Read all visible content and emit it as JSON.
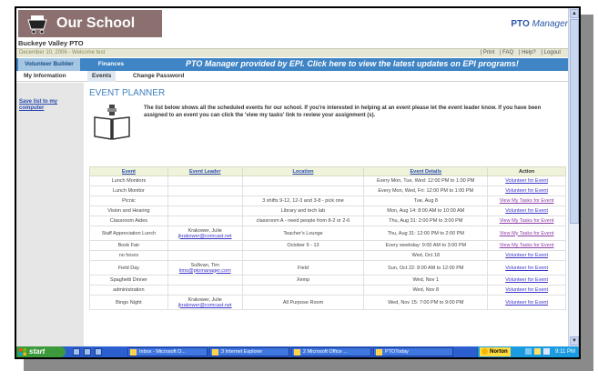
{
  "header": {
    "site_title": "Our School",
    "brand_main": "PTO",
    "brand_sub": "Manager",
    "org_name": "Buckeye Valley PTO"
  },
  "infobar": {
    "date_welcome": "December 10, 2006 - Welcome test",
    "links": [
      "| Print",
      "| FAQ",
      "| Help?",
      "| Logout"
    ]
  },
  "nav": {
    "tab_volunteer": "Volunteer Builder",
    "tab_finances": "Finances",
    "promo": "PTO Manager provided by EPI.  Click here to view the latest updates on EPI programs!"
  },
  "subnav": {
    "my_information": "My Information",
    "events": "Events",
    "change_password": "Change Password"
  },
  "sidebar": {
    "save_link": "Save list to my computer"
  },
  "main": {
    "title": "EVENT PLANNER",
    "description": "The list below shows all the scheduled events for our school. If you're interested in helping at an event please let the event leader know. If you have been assigned to an event you can click the 'view my tasks' link to review your assignment (s)."
  },
  "table": {
    "headers": [
      "Event",
      "Event Leader",
      "Location",
      "Event Details",
      "Action"
    ],
    "rows": [
      {
        "event": "Lunch Monitors",
        "leader": "",
        "email": "",
        "location": "",
        "details": "Every Mon, Tue, Wed: 12:00 PM to 1:00 PM",
        "action": "Volunteer for Event"
      },
      {
        "event": "Lunch Monitor",
        "leader": "",
        "email": "",
        "location": "",
        "details": "Every Mon, Wed, Fri: 12:00 PM to 1:00 PM",
        "action": "Volunteer for Event"
      },
      {
        "event": "Picnic",
        "leader": "",
        "email": "",
        "location": "3 shifts 9-12, 12-3 and 3-8 - pick one",
        "details": "Tue, Aug 8",
        "action": "View My Tasks for Event"
      },
      {
        "event": "Vision and Hearing",
        "leader": "",
        "email": "",
        "location": "Library and tech lab",
        "details": "Mon, Aug 14: 8:00 AM to 10:00 AM",
        "action": "Volunteer for Event"
      },
      {
        "event": "Classroom Aides",
        "leader": "",
        "email": "",
        "location": "classroom A - need people from 8-2 or 2-6",
        "details": "Thu, Aug 31: 2:00 PM to 3:00 PM",
        "action": "View My Tasks for Event"
      },
      {
        "event": "Staff Appreciation Lunch",
        "leader": "Krakower, Julie",
        "email": "jkrakower@comcast.net",
        "location": "Teacher's Lounge",
        "details": "Thu, Aug 31: 12:00 PM to 2:00 PM",
        "action": "View My Tasks for Event"
      },
      {
        "event": "Book Fair",
        "leader": "",
        "email": "",
        "location": "October 9 - 13",
        "details": "Every weekday: 9:00 AM to 3:00 PM",
        "action": "View My Tasks for Event"
      },
      {
        "event": "no hours",
        "leader": "",
        "email": "",
        "location": "",
        "details": "Wed, Oct 18",
        "action": "Volunteer for Event"
      },
      {
        "event": "Field Day",
        "leader": "Sullivan, Tim",
        "email": "timo@ptomanager.com",
        "location": "Field",
        "details": "Sun, Oct 22: 8:00 AM to 12:00 PM",
        "action": "Volunteer for Event"
      },
      {
        "event": "Spaghetti Dinner",
        "leader": "",
        "email": "",
        "location": "Xemp",
        "details": "Wed, Nov 1",
        "action": "Volunteer for Event"
      },
      {
        "event": "administration",
        "leader": "",
        "email": "",
        "location": "",
        "details": "Wed, Nov 8",
        "action": "Volunteer for Event"
      },
      {
        "event": "Bingo Night",
        "leader": "Krakower, Julie",
        "email": "jkrakower@comcast.net",
        "location": "All Purpose Room",
        "details": "Wed, Nov 15: 7:00 PM to 9:00 PM",
        "action": "Volunteer for Event"
      }
    ]
  },
  "taskbar": {
    "start": "start",
    "tasks": [
      "Inbox - Microsoft O...",
      "3 Internet Explorer",
      "2 Microsoft Office ...",
      "PTOToday"
    ],
    "norton": "Norton",
    "clock": "9:11 PM"
  },
  "colors": {
    "nav_blue": "#3f84c4",
    "title_blue": "#3f7fbf",
    "logo_bg": "#8c6f6f",
    "link": "#3a33c9",
    "visited_link": "#8a3aa4",
    "taskbar": "#2b5fcf",
    "start_green": "#3c9a3c"
  },
  "icons": [
    "shopping-cart-icon",
    "open-book-icon",
    "windows-flag-icon",
    "norton-icon"
  ]
}
